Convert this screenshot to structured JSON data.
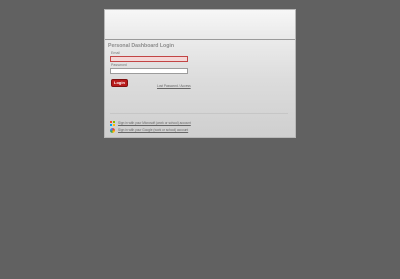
{
  "login": {
    "title": "Personal Dashboard Login",
    "email_label": "Email",
    "email_value": "",
    "password_label": "Password",
    "password_value": "",
    "login_button": "Login",
    "forgot_link": "Lost Password / Access"
  },
  "sso": {
    "microsoft_label": "Sign in with your Microsoft (work or school) account",
    "google_label": "Sign in with your Google (work or school) account"
  },
  "colors": {
    "background": "#616161",
    "accent": "#b91b1b",
    "error_field": "#f4d7d7"
  },
  "icons": {
    "microsoft": "microsoft-icon",
    "google": "google-icon"
  }
}
